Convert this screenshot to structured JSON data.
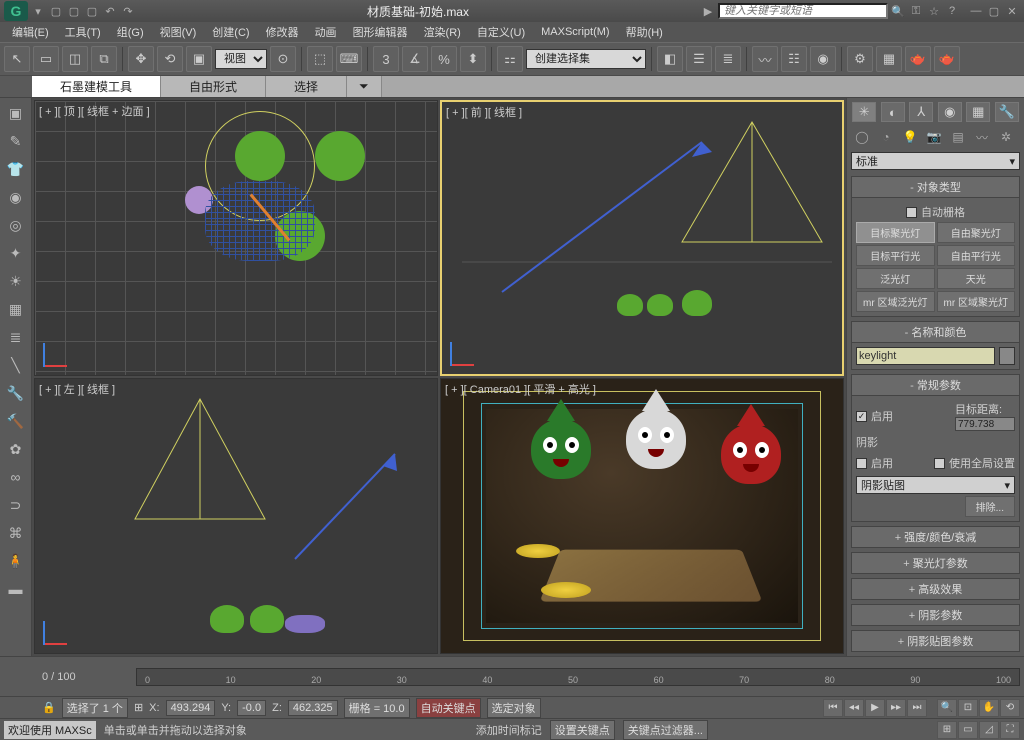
{
  "title": "材质基础-初始.max",
  "search_placeholder": "键入关键字或短语",
  "menu": [
    "编辑(E)",
    "工具(T)",
    "组(G)",
    "视图(V)",
    "创建(C)",
    "修改器",
    "动画",
    "图形编辑器",
    "渲染(R)",
    "自定义(U)",
    "MAXScript(M)",
    "帮助(H)"
  ],
  "toolbar_view_dropdown": "视图",
  "toolbar_selset_dropdown": "创建选择集",
  "ribbon_tabs": [
    "石墨建模工具",
    "自由形式",
    "选择"
  ],
  "viewports": {
    "top": "[ + ][ 顶 ][ 线框 + 边面 ]",
    "front": "[ + ][ 前 ][ 线框 ]",
    "left": "[ + ][ 左 ][ 线框 ]",
    "camera": "[ + ][ Camera01 ][ 平滑 + 高光 ]"
  },
  "panel": {
    "type_dropdown": "标准",
    "rollout_object_type": "对象类型",
    "auto_grid": "自动栅格",
    "buttons": [
      "目标聚光灯",
      "自由聚光灯",
      "目标平行光",
      "自由平行光",
      "泛光灯",
      "天光",
      "mr 区域泛光灯",
      "mr 区域聚光灯"
    ],
    "rollout_name": "名称和颜色",
    "object_name": "keylight",
    "rollout_general": "常规参数",
    "enable": "启用",
    "target_dist_label": "目标距离:",
    "target_dist_value": "779.738",
    "shadow_label": "阴影",
    "use_global": "使用全局设置",
    "shadow_map": "阴影贴图",
    "exclude_btn": "排除...",
    "collapsed_rollouts": [
      "强度/颜色/衰减",
      "聚光灯参数",
      "高级效果",
      "阴影参数",
      "阴影贴图参数"
    ]
  },
  "timeline": {
    "frame_label": "0 / 100",
    "ticks": [
      "0",
      "10",
      "20",
      "30",
      "40",
      "50",
      "60",
      "70",
      "80",
      "90",
      "100"
    ]
  },
  "status": {
    "selected": "选择了 1 个",
    "x_label": "X:",
    "x_value": "493.294",
    "y_label": "Y:",
    "y_value": "-0.0",
    "z_label": "Z:",
    "z_value": "462.325",
    "grid": "栅格 = 10.0",
    "auto_key": "自动关键点",
    "selected_obj": "选定对象"
  },
  "bottom": {
    "welcome": "欢迎使用 MAXSc",
    "hint": "单击或单击并拖动以选择对象",
    "add_time": "添加时间标记",
    "set_key": "设置关键点",
    "key_filter": "关键点过滤器..."
  }
}
